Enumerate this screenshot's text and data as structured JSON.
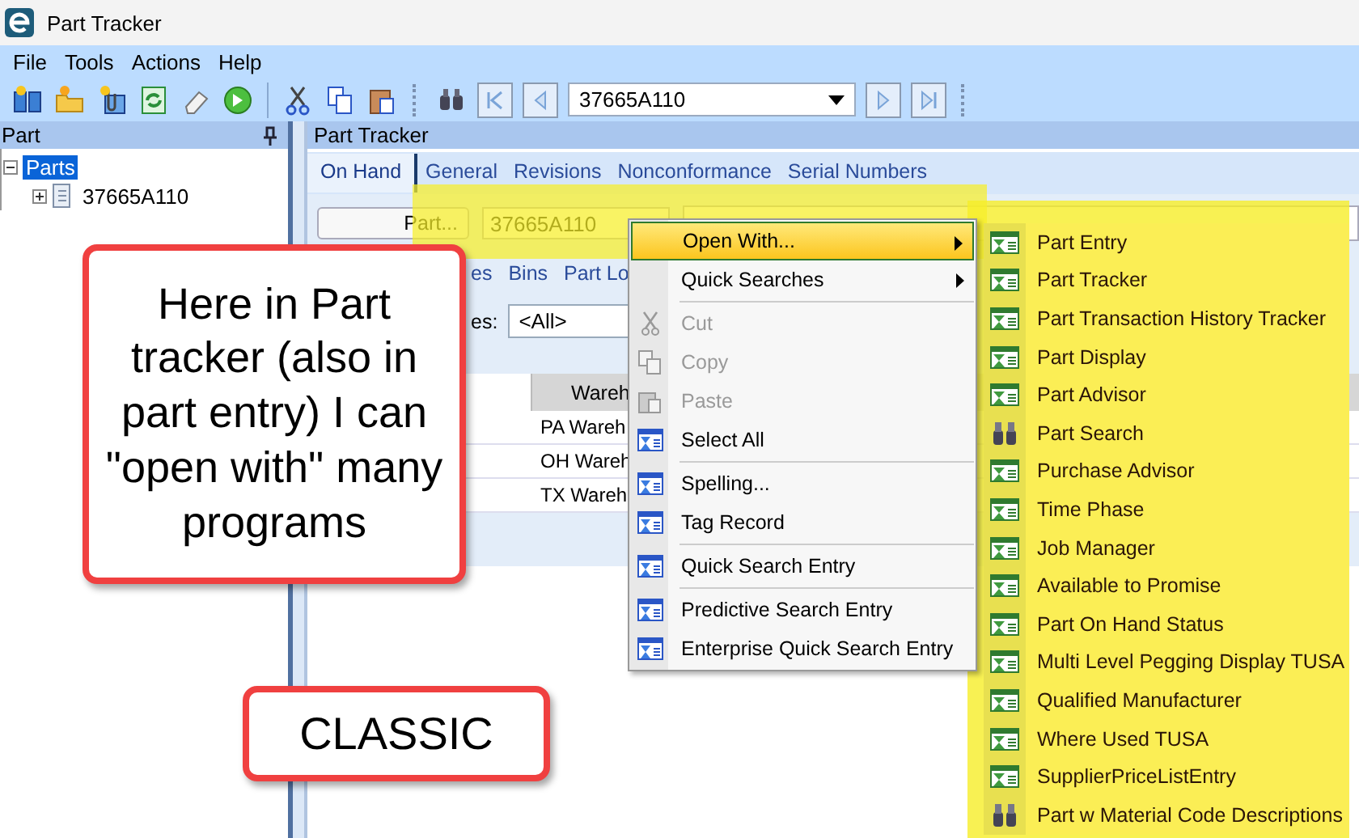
{
  "window": {
    "title": "Part Tracker"
  },
  "menu_bar": [
    "File",
    "Tools",
    "Actions",
    "Help"
  ],
  "toolbar": {
    "part_combo": "37665A110"
  },
  "tree_panel": {
    "title": "Part",
    "items": [
      {
        "label": "Parts",
        "selected": true,
        "expanded": true,
        "children": [
          {
            "label": "37665A110",
            "selected": false,
            "expanded": false
          }
        ]
      }
    ]
  },
  "main_panel": {
    "title": "Part Tracker",
    "tabs": [
      {
        "label": "On Hand",
        "selected": true
      },
      {
        "label": "General",
        "selected": false
      },
      {
        "label": "Revisions",
        "selected": false
      },
      {
        "label": "Nonconformance",
        "selected": false
      },
      {
        "label": "Serial Numbers",
        "selected": false
      }
    ],
    "part_button": "Part...",
    "part_field": "37665A110",
    "sub_tabs": [
      "es",
      "Bins",
      "Part Lo"
    ],
    "filter_label": "es:",
    "filter_value": "<All>",
    "grid": {
      "columns": [
        "Wareh"
      ],
      "rows": [
        [
          "PA Wareh"
        ],
        [
          "OH Wareh"
        ],
        [
          "TX Wareh"
        ]
      ]
    }
  },
  "context_menu": {
    "items": [
      {
        "kind": "submenu",
        "label": "Open With...",
        "selected": true,
        "disabled": false
      },
      {
        "kind": "submenu",
        "label": "Quick Searches",
        "selected": false,
        "disabled": false
      },
      {
        "kind": "separator"
      },
      {
        "kind": "cut",
        "label": "Cut",
        "selected": false,
        "disabled": true
      },
      {
        "kind": "copy",
        "label": "Copy",
        "selected": false,
        "disabled": true
      },
      {
        "kind": "paste",
        "label": "Paste",
        "selected": false,
        "disabled": true
      },
      {
        "kind": "command",
        "label": "Select All",
        "selected": false,
        "disabled": false
      },
      {
        "kind": "separator"
      },
      {
        "kind": "command",
        "label": "Spelling...",
        "selected": false,
        "disabled": false
      },
      {
        "kind": "command",
        "label": "Tag Record",
        "selected": false,
        "disabled": false
      },
      {
        "kind": "separator"
      },
      {
        "kind": "command",
        "label": "Quick Search Entry",
        "selected": false,
        "disabled": false
      },
      {
        "kind": "separator"
      },
      {
        "kind": "command",
        "label": "Predictive Search Entry",
        "selected": false,
        "disabled": false
      },
      {
        "kind": "command",
        "label": "Enterprise Quick Search Entry",
        "selected": false,
        "disabled": false
      }
    ]
  },
  "submenu": {
    "items": [
      {
        "kind": "program",
        "label": "Part Entry"
      },
      {
        "kind": "program",
        "label": "Part Tracker"
      },
      {
        "kind": "program",
        "label": "Part Transaction History Tracker"
      },
      {
        "kind": "program",
        "label": "Part Display"
      },
      {
        "kind": "program",
        "label": "Part Advisor"
      },
      {
        "kind": "search",
        "label": "Part Search"
      },
      {
        "kind": "program",
        "label": "Purchase Advisor"
      },
      {
        "kind": "program",
        "label": "Time Phase"
      },
      {
        "kind": "program",
        "label": "Job Manager"
      },
      {
        "kind": "program",
        "label": "Available to Promise"
      },
      {
        "kind": "program",
        "label": "Part On Hand Status"
      },
      {
        "kind": "program",
        "label": "Multi Level Pegging Display TUSA"
      },
      {
        "kind": "program",
        "label": "Qualified Manufacturer"
      },
      {
        "kind": "program",
        "label": "Where Used TUSA"
      },
      {
        "kind": "program",
        "label": "SupplierPriceListEntry"
      },
      {
        "kind": "search",
        "label": "Part w Material Code Descriptions"
      }
    ]
  },
  "callouts": [
    {
      "text": "Here in Part tracker (also in part entry) I can \"open with\" many programs"
    },
    {
      "text": "CLASSIC"
    }
  ]
}
